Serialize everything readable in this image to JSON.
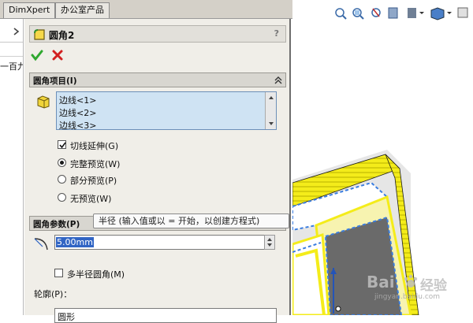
{
  "tabs": [
    "DimXpert",
    "办公室产品"
  ],
  "left_panel": {
    "partial_text": "一百九"
  },
  "feature": {
    "title": "圆角2",
    "help": "?"
  },
  "fillet_items": {
    "header": "圆角项目(I)",
    "edges": [
      "边线<1>",
      "边线<2>",
      "边线<3>"
    ],
    "tangent_propagation": {
      "label": "切线延伸(G)",
      "checked": true
    },
    "preview_options": [
      {
        "label": "完整预览(W)",
        "selected": true
      },
      {
        "label": "部分预览(P)",
        "selected": false
      },
      {
        "label": "无预览(W)",
        "selected": false
      }
    ]
  },
  "fillet_params": {
    "header": "圆角参数(P)",
    "radius_value": "5.00mm",
    "multi_radius": {
      "label": "多半径圆角(M)",
      "checked": false
    },
    "profile_label": "轮廓(P)：",
    "profile_value": "圆形"
  },
  "tooltip": "半径  (输入值或以 = 开始，以创建方程式)",
  "watermark": {
    "brand": "Bai",
    "suffix": "经验",
    "url": "jingyan.baidu.com"
  },
  "colors": {
    "highlight": "#f4ec1a",
    "edge_select": "#3a7de0",
    "accept": "#2fa82f",
    "cancel": "#d22020"
  },
  "icons": [
    "zoom-to-fit-icon",
    "zoom-area-icon",
    "previous-view-icon",
    "section-view-icon",
    "display-style-icon",
    "view-orientation-icon"
  ]
}
